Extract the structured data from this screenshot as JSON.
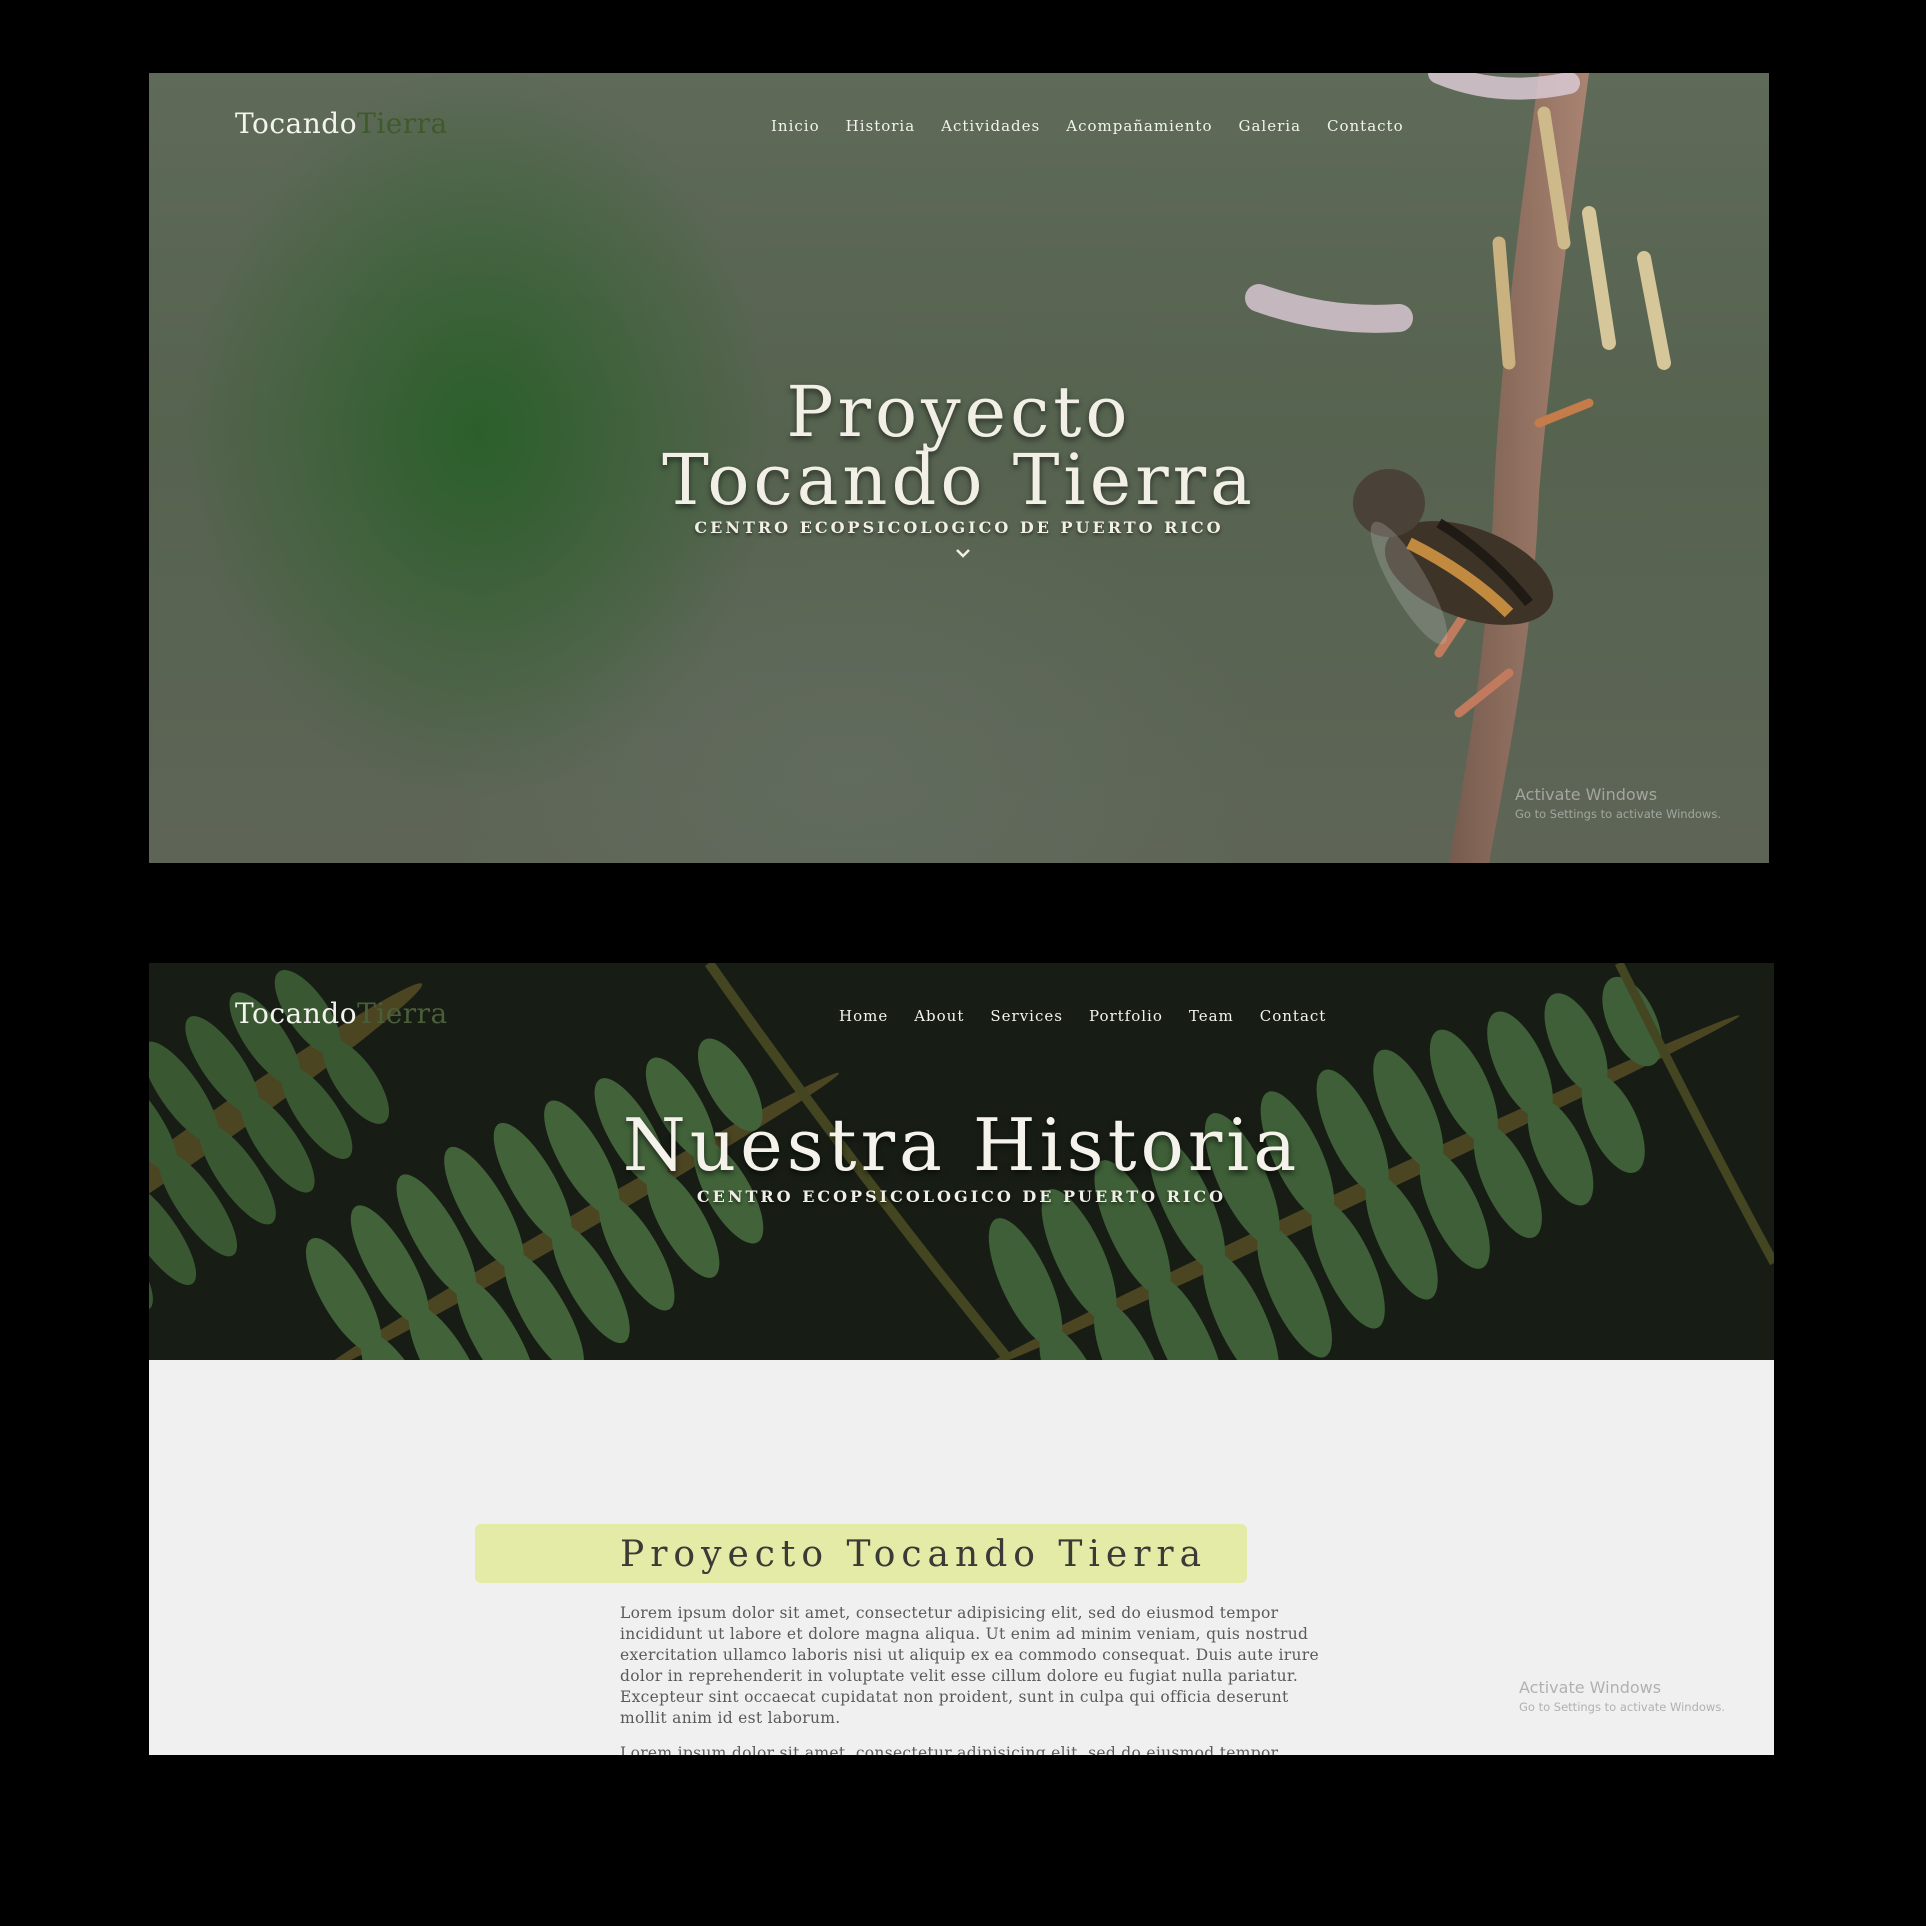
{
  "screen1": {
    "brand": {
      "first": "Tocando",
      "second": "Tierra"
    },
    "nav": [
      "Inicio",
      "Historia",
      "Actividades",
      "Acompañamiento",
      "Galeria",
      "Contacto"
    ],
    "hero": {
      "title_line1": "Proyecto",
      "title_line2": "Tocando Tierra",
      "subtitle": "CENTRO ECOPSICOLOGICO DE PUERTO RICO"
    },
    "watermark": {
      "line1": "Activate Windows",
      "line2": "Go to Settings to activate Windows."
    }
  },
  "screen2": {
    "brand": {
      "first": "Tocando",
      "second": "Tierra"
    },
    "nav": [
      "Home",
      "About",
      "Services",
      "Portfolio",
      "Team",
      "Contact"
    ],
    "hero": {
      "title": "Nuestra Historia",
      "subtitle": "CENTRO ECOPSICOLOGICO DE PUERTO RICO"
    },
    "content": {
      "heading": "Proyecto Tocando Tierra",
      "paragraph1": "Lorem ipsum dolor sit amet, consectetur adipisicing elit, sed do eiusmod tempor incididunt ut labore et dolore magna aliqua. Ut enim ad minim veniam, quis nostrud exercitation ullamco laboris nisi ut aliquip ex ea commodo consequat. Duis aute irure dolor in reprehenderit in voluptate velit esse cillum dolore eu fugiat nulla pariatur. Excepteur sint occaecat cupidatat non proident, sunt in culpa qui officia deserunt mollit anim id est laborum.",
      "paragraph2": "Lorem ipsum dolor sit amet, consectetur adipisicing elit, sed do eiusmod tempor"
    },
    "watermark": {
      "line1": "Activate Windows",
      "line2": "Go to Settings to activate Windows."
    }
  },
  "colors": {
    "background": "#000000",
    "brand_accent": "#3f5a2b",
    "heading_highlight": "#e4eba6",
    "content_bg": "#f0f0f0"
  },
  "icons": {
    "scroll_down": "chevron-down-icon"
  }
}
